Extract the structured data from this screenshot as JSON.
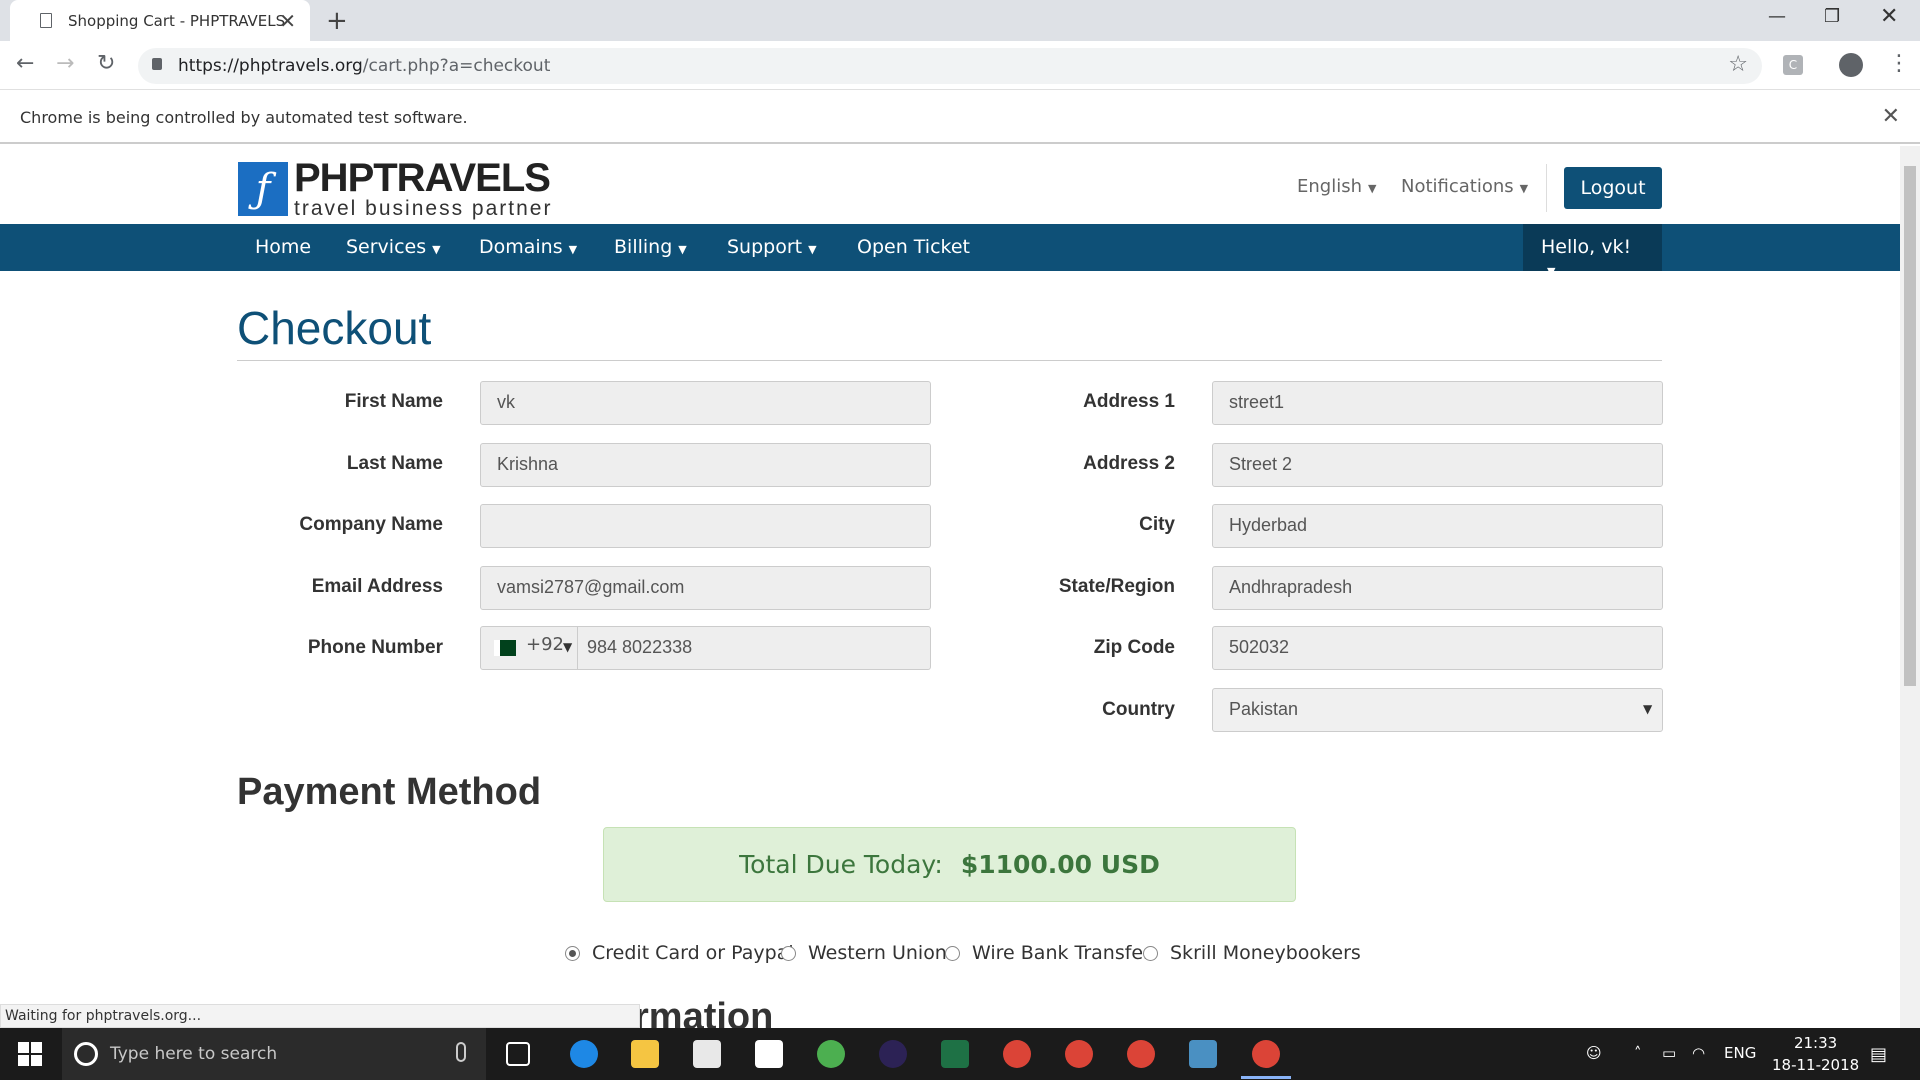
{
  "browser": {
    "tab_title": "Shopping Cart - PHPTRAVELS",
    "tab_close": "✕",
    "new_tab": "+",
    "url_host": "https://phptravels.org",
    "url_path": "/cart.php?a=checkout",
    "infobar_text": "Chrome is being controlled by automated test software.",
    "extension_label": "C",
    "status_text": "Waiting for phptravels.org..."
  },
  "site": {
    "logo_title": "PHPTRAVELS",
    "logo_tagline": "travel business partner",
    "language": "English",
    "notifications": "Notifications",
    "logout": "Logout",
    "nav": [
      "Home",
      "Services",
      "Domains",
      "Billing",
      "Support",
      "Open Ticket"
    ],
    "hello": "Hello, vk!"
  },
  "checkout": {
    "heading": "Checkout",
    "left": [
      {
        "label": "First Name",
        "value": "vk"
      },
      {
        "label": "Last Name",
        "value": "Krishna"
      },
      {
        "label": "Company Name",
        "value": ""
      },
      {
        "label": "Email Address",
        "value": "vamsi2787@gmail.com"
      },
      {
        "label": "Phone Number",
        "value": "984 8022338"
      }
    ],
    "phone_code": "+92",
    "right": [
      {
        "label": "Address 1",
        "value": "street1"
      },
      {
        "label": "Address 2",
        "value": "Street 2"
      },
      {
        "label": "City",
        "value": "Hyderbad"
      },
      {
        "label": "State/Region",
        "value": "Andhrapradesh"
      },
      {
        "label": "Zip Code",
        "value": "502032"
      },
      {
        "label": "Country",
        "value": "Pakistan"
      }
    ]
  },
  "payment": {
    "heading": "Payment Method",
    "total_label": "Total Due Today:",
    "total_value": "$1100.00 USD",
    "methods": [
      "Credit Card or Paypal",
      "Western Union",
      "Wire Bank Transfer",
      "Skrill Moneybookers"
    ],
    "selected_index": 0,
    "next_heading_partial": "rmation"
  },
  "taskbar": {
    "search_placeholder": "Type here to search",
    "lang": "ENG",
    "time": "21:33",
    "date": "18-11-2018"
  }
}
